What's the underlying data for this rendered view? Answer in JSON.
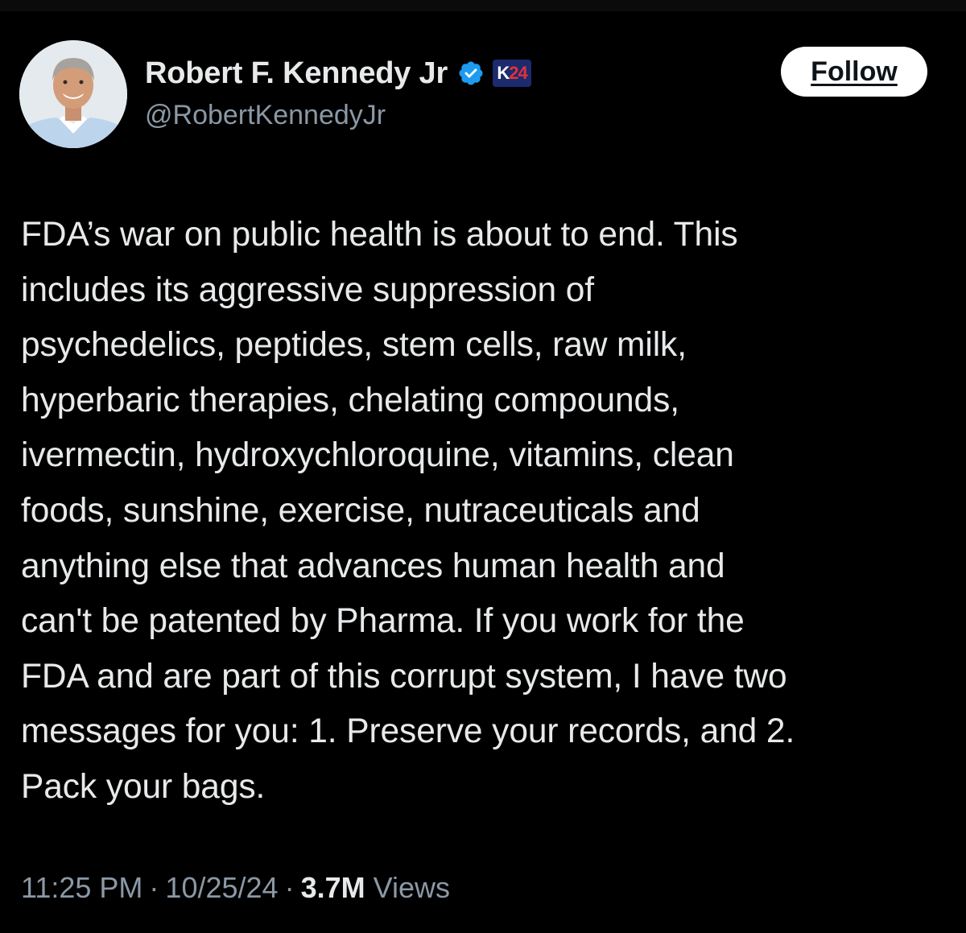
{
  "author": {
    "display_name": "Robert F. Kennedy Jr",
    "handle": "@RobertKennedyJr",
    "avatar_icon": "profile-photo-icon",
    "verified_icon": "verified-badge-icon",
    "badge": {
      "letter": "K",
      "number": "24"
    }
  },
  "follow_label": "Follow",
  "post": {
    "text": "FDA’s war on public health is about to end. This\nincludes its aggressive suppression of\npsychedelics, peptides, stem cells, raw milk,\nhyperbaric therapies, chelating compounds,\nivermectin, hydroxychloroquine, vitamins, clean\nfoods, sunshine, exercise, nutraceuticals and\nanything else that advances human health and\ncan't be patented by Pharma. If you work for the\nFDA and are part of this corrupt system, I have two\nmessages for you: 1. Preserve your records, and 2.\nPack your bags."
  },
  "meta": {
    "time": "11:25 PM",
    "separator": "·",
    "date": "10/25/24",
    "views_count": "3.7M",
    "views_label": "Views"
  },
  "colors": {
    "background": "#000000",
    "text_primary": "#e7e9ea",
    "text_secondary": "#8b98a5",
    "verified_blue": "#1d9bf0",
    "button_bg": "#ffffff",
    "badge_navy": "#1c2a6e",
    "badge_red": "#e2323a"
  }
}
